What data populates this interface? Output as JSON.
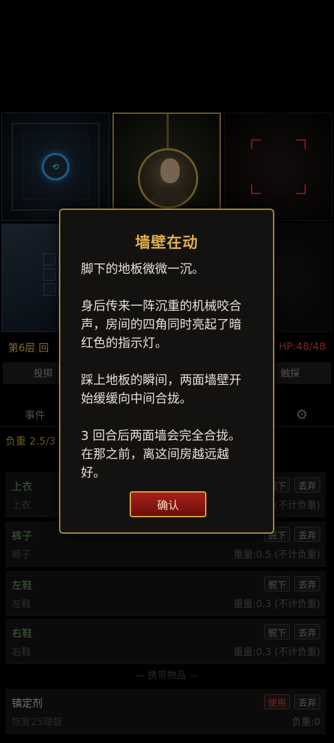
{
  "hud": {
    "floor_text": "第6层 回",
    "hp_text": "HP:48/48"
  },
  "actions": {
    "throw_label": "投掷",
    "touch_label": "触探"
  },
  "tabs": {
    "events_label": "事件"
  },
  "load_text": "负重 2.5/3",
  "equipment": [
    {
      "name": "上衣",
      "sub": "上衣",
      "weight": "(不计负重)",
      "take_label": "脱下",
      "drop_label": "丢弃"
    },
    {
      "name": "裤子",
      "sub": "裤子",
      "weight": "重量:0.5 (不计负重)",
      "take_label": "脱下",
      "drop_label": "丢弃"
    },
    {
      "name": "左鞋",
      "sub": "左鞋",
      "weight": "重量:0.3 (不计负重)",
      "take_label": "脱下",
      "drop_label": "丢弃"
    },
    {
      "name": "右鞋",
      "sub": "右鞋",
      "weight": "重量:0.3 (不计负重)",
      "take_label": "脱下",
      "drop_label": "丢弃"
    }
  ],
  "carried_section_title": "— 携带物品 —",
  "carried": [
    {
      "name": "镇定剂",
      "sub": "恢复25理智",
      "weight": "负重:0",
      "use_label": "使用",
      "drop_label": "丢弃"
    }
  ],
  "modal": {
    "title": "墙壁在动",
    "paragraphs": [
      "脚下的地板微微一沉。",
      "身后传来一阵沉重的机械咬合声，房间的四角同时亮起了暗红色的指示灯。",
      "踩上地板的瞬间，两面墙壁开始缓缓向中间合拢。",
      "3 回合后两面墙会完全合拢。在那之前，离这间房越远越好。"
    ],
    "confirm_label": "确认"
  },
  "colors": {
    "accent_gold": "#a88a3a",
    "title_gold": "#e2b04a",
    "hp_red": "#c0392b",
    "confirm_red": "#a8201a"
  }
}
